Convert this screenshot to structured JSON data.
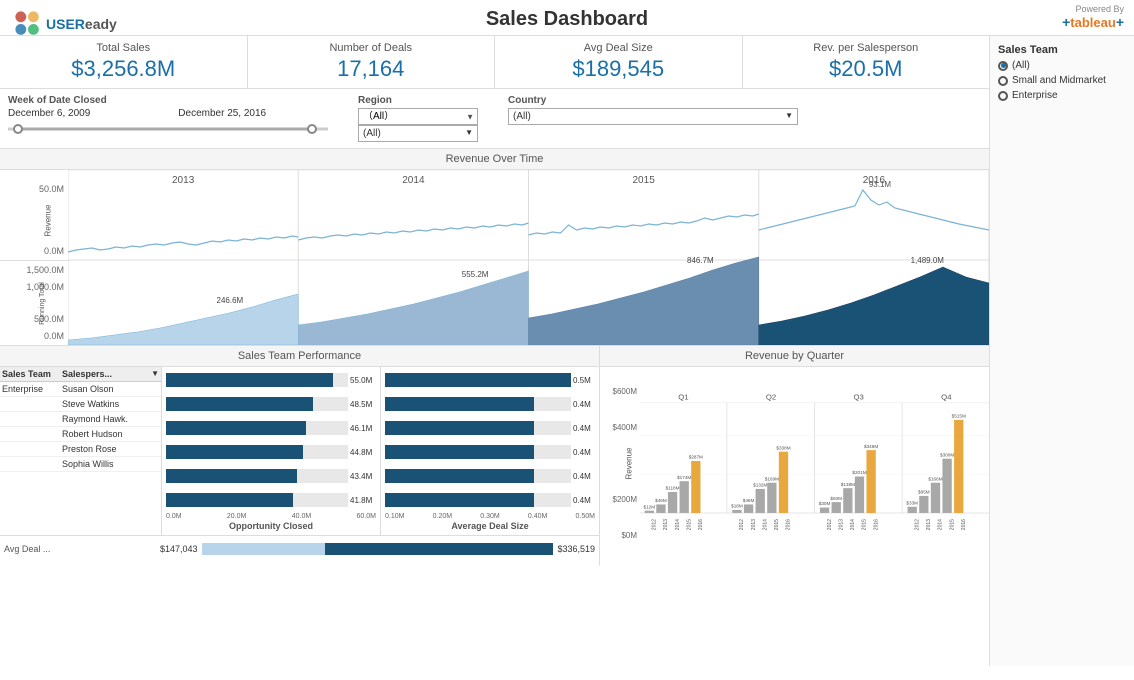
{
  "header": {
    "title": "Sales Dashboard",
    "logo_text": "USEReady",
    "powered_by": "Powered By",
    "tableau": "+tableau+"
  },
  "kpis": [
    {
      "label": "Total Sales",
      "value": "$3,256.8M"
    },
    {
      "label": "Number of Deals",
      "value": "17,164"
    },
    {
      "label": "Avg Deal Size",
      "value": "$189,545"
    },
    {
      "label": "Rev. per Salesperson",
      "value": "$20.5M"
    }
  ],
  "filters": {
    "date_label": "Week of Date Closed",
    "date_start": "December 6, 2009",
    "date_end": "December 25, 2016",
    "region_label": "Region",
    "region_value": "(All)",
    "country_label": "Country",
    "country_value": "(All)"
  },
  "revenue_chart": {
    "title": "Revenue Over Time",
    "years": [
      "2013",
      "2014",
      "2015",
      "2016"
    ],
    "y_axis_top": [
      "50.0M",
      "0.0M"
    ],
    "y_axis_bottom": [
      "1,500.0M",
      "1,000.0M",
      "500.0M",
      "0.0M"
    ],
    "annotations": {
      "y2013_total": "246.6M",
      "y2014_total": "555.2M",
      "y2015_total": "846.7M",
      "y2016_total": "1,489.0M",
      "y2016_peak": "93.1M"
    }
  },
  "sales_team_perf": {
    "title": "Sales Team Performance",
    "table_headers": [
      "Sales Team",
      "Salespers...",
      ""
    ],
    "rows": [
      {
        "team": "Enterprise",
        "person": "Susan Olson",
        "opp_closed": 55.0,
        "avg_deal": 0.5
      },
      {
        "team": "",
        "person": "Steve Watkins",
        "opp_closed": 48.5,
        "avg_deal": 0.4
      },
      {
        "team": "",
        "person": "Raymond Hawk.",
        "opp_closed": 46.1,
        "avg_deal": 0.4
      },
      {
        "team": "",
        "person": "Robert Hudson",
        "opp_closed": 44.8,
        "avg_deal": 0.4
      },
      {
        "team": "",
        "person": "Preston Rose",
        "opp_closed": 43.4,
        "avg_deal": 0.4
      },
      {
        "team": "",
        "person": "Sophia Willis",
        "opp_closed": 41.8,
        "avg_deal": 0.4
      }
    ],
    "opp_axis": [
      "0.0M",
      "20.0M",
      "40.0M",
      "60.0M"
    ],
    "deal_axis": [
      "0.10M",
      "0.20M",
      "0.30M",
      "0.40M",
      "0.50M"
    ],
    "opp_label": "Opportunity Closed",
    "deal_label": "Average Deal Size",
    "avg_deal_label": "Avg Deal ...",
    "avg_deal_left": "$147,043",
    "avg_deal_right": "$336,519"
  },
  "revenue_by_quarter": {
    "title": "Revenue by Quarter",
    "quarters": [
      "Q1",
      "Q2",
      "Q3",
      "Q4"
    ],
    "y_axis": [
      "$600M",
      "$400M",
      "$200M",
      "$0M"
    ],
    "bars": {
      "Q1": [
        {
          "year": "2012",
          "value": 12,
          "label": "$12M",
          "color": "#a8a8a8"
        },
        {
          "year": "2013",
          "value": 46,
          "label": "$46M",
          "color": "#a8a8a8"
        },
        {
          "year": "2014",
          "value": 118,
          "label": "$118M",
          "color": "#a8a8a8"
        },
        {
          "year": "2015",
          "value": 174,
          "label": "$174M",
          "color": "#a8a8a8"
        },
        {
          "year": "2016",
          "value": 287,
          "label": "$287M",
          "color": "#e8a83e"
        }
      ],
      "Q2": [
        {
          "year": "2012",
          "value": 18,
          "label": "$18M",
          "color": "#a8a8a8"
        },
        {
          "year": "2013",
          "value": 46,
          "label": "$46M",
          "color": "#a8a8a8"
        },
        {
          "year": "2014",
          "value": 132,
          "label": "$132M",
          "color": "#a8a8a8"
        },
        {
          "year": "2015",
          "value": 169,
          "label": "$169M",
          "color": "#a8a8a8"
        },
        {
          "year": "2016",
          "value": 338,
          "label": "$338M",
          "color": "#e8a83e"
        }
      ],
      "Q3": [
        {
          "year": "2012",
          "value": 30,
          "label": "$30M",
          "color": "#a8a8a8"
        },
        {
          "year": "2013",
          "value": 60,
          "label": "$60M",
          "color": "#a8a8a8"
        },
        {
          "year": "2014",
          "value": 138,
          "label": "$138M",
          "color": "#a8a8a8"
        },
        {
          "year": "2015",
          "value": 201,
          "label": "$201M",
          "color": "#a8a8a8"
        },
        {
          "year": "2016",
          "value": 348,
          "label": "$348M",
          "color": "#e8a83e"
        }
      ],
      "Q4": [
        {
          "year": "2012",
          "value": 33,
          "label": "$33M",
          "color": "#a8a8a8"
        },
        {
          "year": "2013",
          "value": 95,
          "label": "$95M",
          "color": "#a8a8a8"
        },
        {
          "year": "2014",
          "value": 166,
          "label": "$166M",
          "color": "#a8a8a8"
        },
        {
          "year": "2015",
          "value": 300,
          "label": "$300M",
          "color": "#a8a8a8"
        },
        {
          "year": "2016",
          "value": 515,
          "label": "$515M",
          "color": "#e8a83e"
        }
      ]
    }
  },
  "sales_team_filter": {
    "title": "Sales Team",
    "options": [
      {
        "label": "(All)",
        "selected": true
      },
      {
        "label": "Small and Midmarket",
        "selected": false
      },
      {
        "label": "Enterprise",
        "selected": false
      }
    ]
  }
}
